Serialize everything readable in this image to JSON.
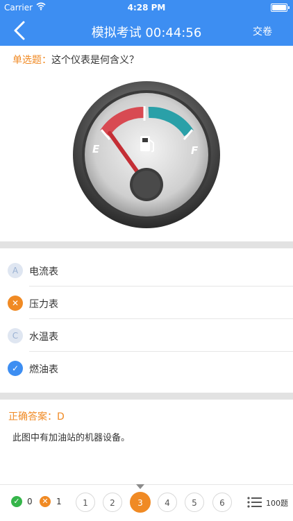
{
  "status_bar": {
    "carrier": "Carrier",
    "time": "4:28 PM"
  },
  "nav": {
    "back_icon": "chevron-left-icon",
    "title": "模拟考试 00:44:56",
    "submit_label": "交卷"
  },
  "question": {
    "type_label": "单选题：",
    "text": "这个仪表是何含义？"
  },
  "gauge": {
    "empty_label": "E",
    "full_label": "F",
    "icon": "fuel-pump-icon"
  },
  "options": [
    {
      "badge": "A",
      "label": "电流表",
      "state": "plain"
    },
    {
      "badge": "✕",
      "label": "压力表",
      "state": "wrong"
    },
    {
      "badge": "C",
      "label": "水温表",
      "state": "plain"
    },
    {
      "badge": "✓",
      "label": "燃油表",
      "state": "right"
    }
  ],
  "answer": {
    "text": "正确答案：D"
  },
  "explanation": {
    "text": "此图中有加油站的机器设备。"
  },
  "bottom": {
    "correct_count": "0",
    "wrong_count": "1",
    "numbers": [
      "1",
      "2",
      "3",
      "4",
      "5",
      "6"
    ],
    "current": "3",
    "total_label": "100题"
  },
  "colors": {
    "accent": "#3d8ef2",
    "orange": "#f08a24"
  }
}
